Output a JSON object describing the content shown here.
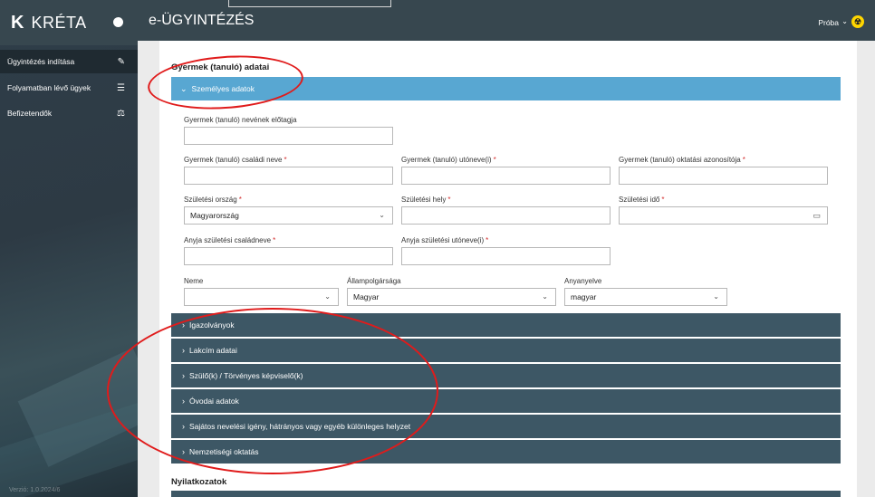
{
  "sidebar": {
    "logo_mark": "K",
    "logo_text": "KRÉTA",
    "items": [
      {
        "label": "Ügyintézés indítása",
        "icon": "✎"
      },
      {
        "label": "Folyamatban lévő ügyek",
        "icon": "☰"
      },
      {
        "label": "Befizetendők",
        "icon": "⚖"
      }
    ],
    "footer": "Verzió: 1.0.2024/6"
  },
  "topbar": {
    "title": "e-ÜGYINTÉZÉS",
    "user": "Próba",
    "chevron": "⌄",
    "badge": "☢"
  },
  "main": {
    "section_title": "Gyermek (tanuló) adatai",
    "open_panel": "Személyes adatok",
    "fields": {
      "prefix_label": "Gyermek (tanuló) nevének előtagja",
      "family_label": "Gyermek (tanuló) családi neve",
      "given_label": "Gyermek (tanuló) utóneve(i)",
      "edu_id_label": "Gyermek (tanuló) oktatási azonosítója",
      "birth_country_label": "Születési ország",
      "birth_country_value": "Magyarország",
      "birth_place_label": "Születési hely",
      "birth_date_label": "Születési idő",
      "mother_family_label": "Anyja születési családneve",
      "mother_given_label": "Anyja születési utóneve(i)",
      "sex_label": "Neme",
      "sex_value": "",
      "citizenship_label": "Állampolgársága",
      "citizenship_value": "Magyar",
      "language_label": "Anyanyelve",
      "language_value": "magyar",
      "required_mark": "*"
    },
    "panels": [
      "Igazolványok",
      "Lakcím adatai",
      "Szülő(k) / Törvényes képviselő(k)",
      "Óvodai adatok",
      "Sajátos nevelési igény, hátrányos vagy egyéb különleges helyzet",
      "Nemzetiségi oktatás"
    ],
    "section_title2": "Nyilatkozatok"
  },
  "colors": {
    "annotation": "#e01b1b",
    "open_panel": "#58a7d2",
    "panel": "#3d5765",
    "topbar": "#37474f"
  }
}
